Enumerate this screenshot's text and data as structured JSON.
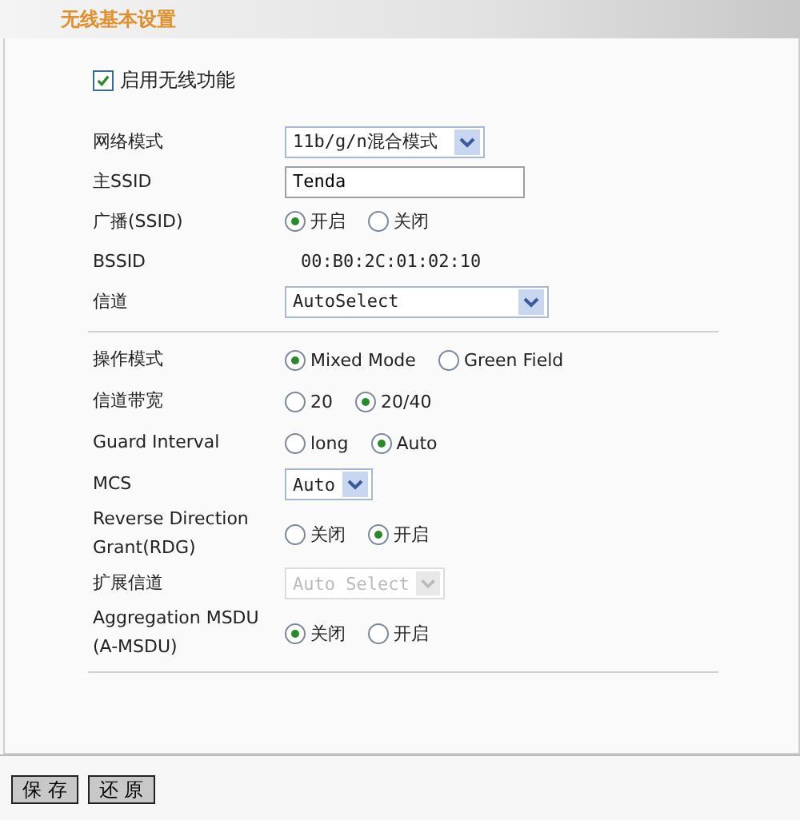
{
  "title": "无线基本设置",
  "enable_wireless": {
    "label": "启用无线功能",
    "checked": true
  },
  "sections": [
    {
      "rows": [
        {
          "label": "网络模式",
          "kind": "select",
          "value": "11b/g/n混合模式",
          "disabled": false
        },
        {
          "label": "主SSID",
          "kind": "text",
          "value": "Tenda"
        },
        {
          "label": "广播(SSID)",
          "kind": "radio",
          "options": [
            {
              "label": "开启",
              "selected": true
            },
            {
              "label": "关闭",
              "selected": false
            }
          ]
        },
        {
          "label": "BSSID",
          "kind": "static",
          "value": "00:B0:2C:01:02:10"
        },
        {
          "label": "信道",
          "kind": "select",
          "value": "AutoSelect",
          "disabled": false
        }
      ]
    },
    {
      "rows": [
        {
          "label": "操作模式",
          "kind": "radio",
          "options": [
            {
              "label": "Mixed Mode",
              "selected": true
            },
            {
              "label": "Green Field",
              "selected": false
            }
          ]
        },
        {
          "label": "信道带宽",
          "kind": "radio",
          "options": [
            {
              "label": "20",
              "selected": false
            },
            {
              "label": "20/40",
              "selected": true
            }
          ]
        },
        {
          "label": "Guard Interval",
          "kind": "radio",
          "options": [
            {
              "label": "long",
              "selected": false
            },
            {
              "label": "Auto",
              "selected": true
            }
          ]
        },
        {
          "label": "MCS",
          "kind": "select",
          "value": "Auto",
          "disabled": false
        },
        {
          "label": "Reverse Direction Grant(RDG)",
          "kind": "radio",
          "options": [
            {
              "label": "关闭",
              "selected": false
            },
            {
              "label": "开启",
              "selected": true
            }
          ]
        },
        {
          "label": "扩展信道",
          "kind": "select",
          "value": "Auto Select",
          "disabled": true
        },
        {
          "label": "Aggregation MSDU (A-MSDU)",
          "kind": "radio",
          "options": [
            {
              "label": "关闭",
              "selected": true
            },
            {
              "label": "开启",
              "selected": false
            }
          ]
        }
      ]
    }
  ],
  "buttons": [
    "保 存",
    "还 原"
  ]
}
